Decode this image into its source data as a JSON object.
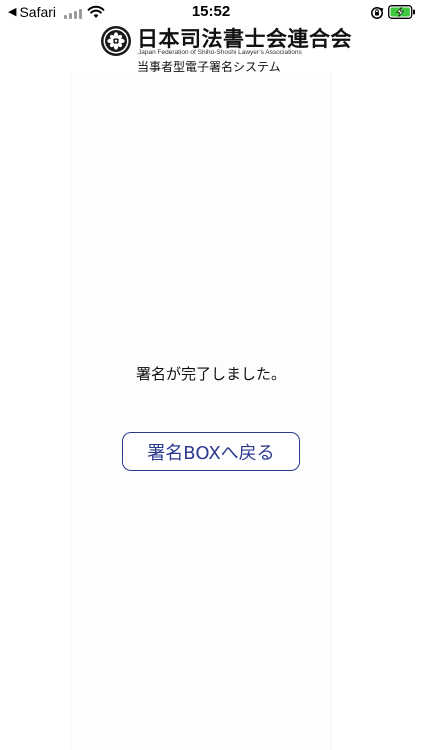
{
  "status_bar": {
    "back_app": "Safari",
    "time": "15:52",
    "icons": [
      "back-triangle-icon",
      "signal-icon",
      "wifi-icon",
      "orientation-lock-icon",
      "battery-charging-icon"
    ],
    "battery_color": "#3ec93e"
  },
  "header": {
    "org_name_ja": "日本司法書士会連合会",
    "org_name_en": "Japan Federation of Shiho-Shoshi Lawyer’s Associations",
    "system_name": "当事者型電子署名システム",
    "logo_icon": "seal-logo-icon"
  },
  "main": {
    "message": "署名が完了しました。",
    "back_button_label": "署名BOXへ戻る",
    "accent_color": "#2b3a8f"
  }
}
